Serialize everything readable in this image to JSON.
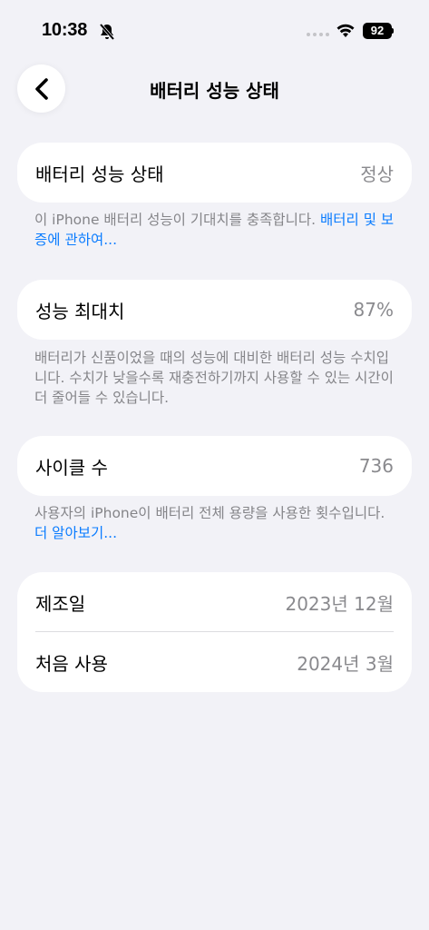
{
  "status_bar": {
    "time": "10:38",
    "battery_level": "92",
    "icons": [
      "bell-slash-icon",
      "signal-dots-icon",
      "wifi-icon",
      "battery-icon"
    ]
  },
  "nav": {
    "title": "배터리 성능 상태",
    "back_icon": "chevron-left-icon"
  },
  "battery_health": {
    "label": "배터리 성능 상태",
    "value": "정상",
    "footnote": "이 iPhone 배터리 성능이 기대치를 충족합니다. ",
    "footnote_link": "배터리 및 보증에 관하여..."
  },
  "max_capacity": {
    "label": "성능 최대치",
    "value": "87%",
    "footnote": "배터리가 신품이었을 때의 성능에 대비한 배터리 성능 수치입니다. 수치가 낮을수록 재충전하기까지 사용할 수 있는 시간이 더 줄어들 수 있습니다."
  },
  "cycle_count": {
    "label": "사이클 수",
    "value": "736",
    "footnote": "사용자의 iPhone이 배터리 전체 용량을 사용한 횟수입니다. ",
    "footnote_link": "더 알아보기..."
  },
  "dates": {
    "manufacture_label": "제조일",
    "manufacture_value": "2023년 12월",
    "first_use_label": "처음 사용",
    "first_use_value": "2024년 3월"
  },
  "colors": {
    "background": "#f2f2f7",
    "card": "#ffffff",
    "link": "#0a7cff",
    "secondary_text": "#8a8a8e"
  }
}
